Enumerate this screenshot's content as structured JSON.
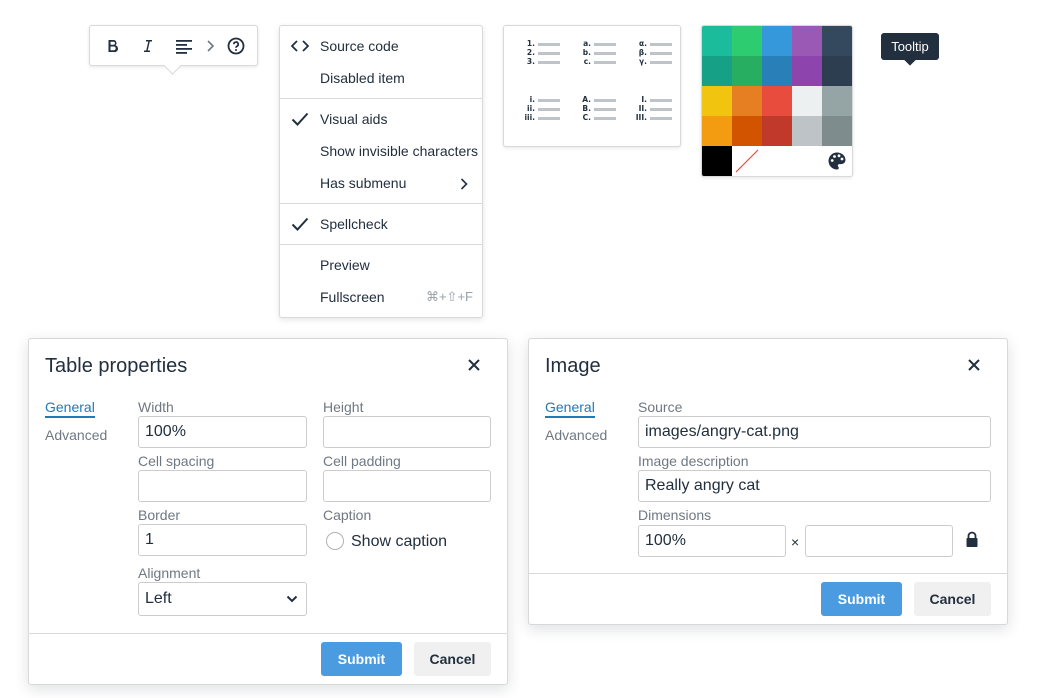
{
  "toolbar": {
    "buttons": [
      {
        "icon": "bold-icon"
      },
      {
        "icon": "italic-icon"
      },
      {
        "icon": "align-left-icon"
      },
      {
        "icon": "chevron-right-icon"
      },
      {
        "icon": "help-icon"
      }
    ]
  },
  "menu": {
    "items": [
      {
        "label": "Source code",
        "icon": "source-code-icon",
        "shortcut": ""
      },
      {
        "label": "Disabled item",
        "icon": "",
        "shortcut": ""
      },
      {
        "label": "Visual aids",
        "icon": "checkmark-icon",
        "shortcut": ""
      },
      {
        "label": "Show invisible characters",
        "icon": "",
        "shortcut": ""
      },
      {
        "label": "Has submenu",
        "icon": "chevron-right-icon",
        "shortcut": ""
      },
      {
        "label": "Spellcheck",
        "icon": "checkmark-icon",
        "shortcut": ""
      },
      {
        "label": "Preview",
        "icon": "",
        "shortcut": ""
      },
      {
        "label": "Fullscreen",
        "icon": "",
        "shortcut": "⌘+⇧+F"
      }
    ]
  },
  "list_styles": [
    {
      "markers": [
        "1.",
        "2.",
        "3."
      ]
    },
    {
      "markers": [
        "a.",
        "b.",
        "c."
      ]
    },
    {
      "markers": [
        "α.",
        "β.",
        "γ."
      ]
    },
    {
      "markers": [
        "i.",
        "ii.",
        "iii."
      ]
    },
    {
      "markers": [
        "A.",
        "B.",
        "C."
      ]
    },
    {
      "markers": [
        "I.",
        "II.",
        "III."
      ]
    }
  ],
  "swatches": {
    "colors": [
      "#1abc9c",
      "#2ecc71",
      "#3498db",
      "#9b59b6",
      "#34495e",
      "#16a085",
      "#27ae60",
      "#2980b9",
      "#8e44ad",
      "#2c3e50",
      "#f1c40f",
      "#e67e22",
      "#e74c3c",
      "#ecf0f1",
      "#95a5a6",
      "#f39c12",
      "#d35400",
      "#c0392b",
      "#bdc3c7",
      "#7f8c8d",
      "#000000"
    ],
    "remove_color_icon": "remove-color-icon",
    "custom_color_icon": "palette-icon"
  },
  "tooltip": {
    "text": "Tooltip"
  },
  "table_dialog": {
    "title": "Table properties",
    "tabs": [
      {
        "label": "General"
      },
      {
        "label": "Advanced"
      }
    ],
    "fields": {
      "width": {
        "label": "Width",
        "value": "100%"
      },
      "height": {
        "label": "Height",
        "value": ""
      },
      "cell_spacing": {
        "label": "Cell spacing",
        "value": ""
      },
      "cell_padding": {
        "label": "Cell padding",
        "value": ""
      },
      "border": {
        "label": "Border",
        "value": "1"
      },
      "caption": {
        "label": "Caption",
        "option": "Show caption",
        "checked": false
      },
      "alignment": {
        "label": "Alignment",
        "value": "Left"
      }
    },
    "submit": "Submit",
    "cancel": "Cancel"
  },
  "image_dialog": {
    "title": "Image",
    "tabs": [
      {
        "label": "General"
      },
      {
        "label": "Advanced"
      }
    ],
    "fields": {
      "source": {
        "label": "Source",
        "value": "images/angry-cat.png"
      },
      "description": {
        "label": "Image description",
        "value": "Really angry cat"
      },
      "dimensions": {
        "label": "Dimensions",
        "width": "100%",
        "height": "",
        "separator": "×"
      }
    },
    "submit": "Submit",
    "cancel": "Cancel"
  }
}
